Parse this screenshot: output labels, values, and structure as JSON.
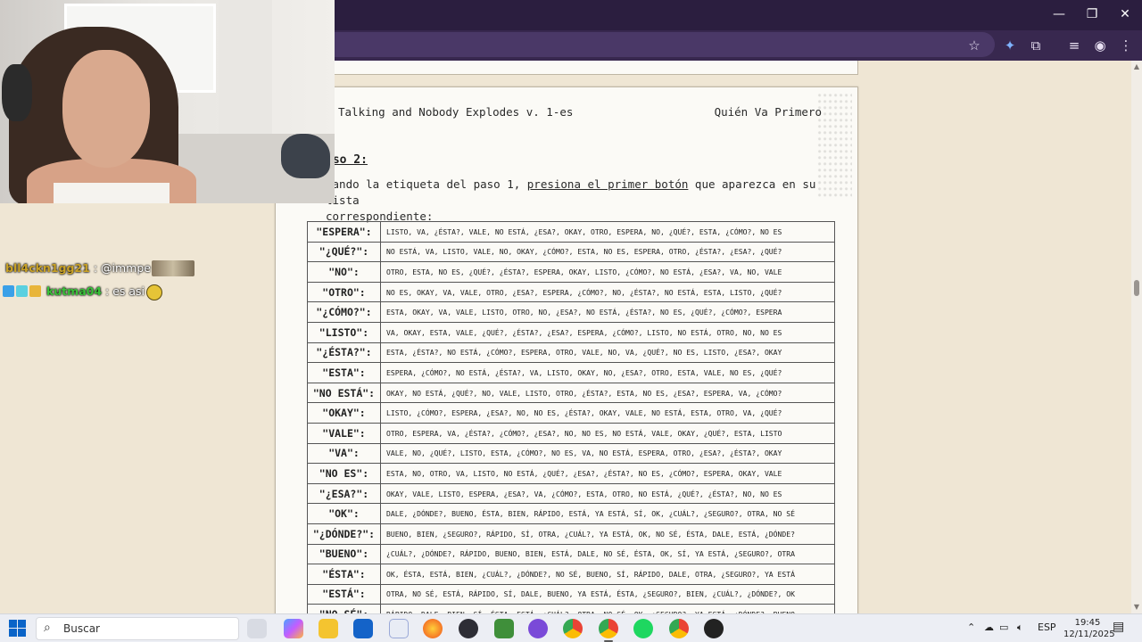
{
  "browser": {
    "window_controls": {
      "minimize": "—",
      "restore": "❐",
      "close": "✕"
    },
    "toolbar_icons": [
      "star-icon",
      "extension-puzzle-icon",
      "media-icon",
      "profile-icon",
      "menu-icon"
    ]
  },
  "document": {
    "header_left": "Talking and Nobody Explodes v. 1-es",
    "header_right": "Quién Va Primero",
    "step_label": "aso 2:",
    "instruction_pre": "sando la etiqueta del paso 1, ",
    "instruction_link": "presiona el primer botón",
    "instruction_post": " que aparezca en su lista",
    "instruction_line2": "correspondiente:",
    "rows": [
      {
        "key": "\"ESPERA\":",
        "list": "LISTO, VA, ¿ÉSTA?, VALE, NO ESTÁ, ¿ESA?, OKAY, OTRO, ESPERA, NO, ¿QUÉ?, ESTA, ¿CÓMO?, NO ES"
      },
      {
        "key": "\"¿QUÉ?\":",
        "list": "NO ESTÁ, VA, LISTO, VALE, NO, OKAY, ¿CÓMO?, ESTA, NO ES, ESPERA, OTRO, ¿ÉSTA?, ¿ESA?, ¿QUÉ?"
      },
      {
        "key": "\"NO\":",
        "list": "OTRO, ESTA, NO ES, ¿QUÉ?, ¿ÉSTA?, ESPERA, OKAY, LISTO, ¿CÓMO?, NO ESTÁ, ¿ESA?, VA, NO, VALE"
      },
      {
        "key": "\"OTRO\":",
        "list": "NO ES, OKAY, VA, VALE, OTRO, ¿ESA?, ESPERA, ¿CÓMO?, NO, ¿ÉSTA?, NO ESTÁ, ESTA, LISTO, ¿QUÉ?"
      },
      {
        "key": "\"¿CÓMO?\":",
        "list": "ESTA, OKAY, VA, VALE, LISTO, OTRO, NO, ¿ESA?, NO ESTÁ, ¿ÉSTA?, NO ES, ¿QUÉ?, ¿CÓMO?, ESPERA"
      },
      {
        "key": "\"LISTO\":",
        "list": "VA, OKAY, ESTA, VALE, ¿QUÉ?, ¿ÉSTA?, ¿ESA?, ESPERA, ¿CÓMO?, LISTO, NO ESTÁ, OTRO, NO, NO ES"
      },
      {
        "key": "\"¿ÉSTA?\":",
        "list": "ESTA, ¿ÉSTA?, NO ESTÁ, ¿CÓMO?, ESPERA, OTRO, VALE, NO, VA, ¿QUÉ?, NO ES, LISTO, ¿ESA?, OKAY"
      },
      {
        "key": "\"ESTA\":",
        "list": "ESPERA, ¿CÓMO?, NO ESTÁ, ¿ÉSTA?, VA, LISTO, OKAY, NO, ¿ESA?, OTRO, ESTA, VALE, NO ES, ¿QUÉ?"
      },
      {
        "key": "\"NO ESTÁ\":",
        "list": "OKAY, NO ESTÁ, ¿QUÉ?, NO, VALE, LISTO, OTRO, ¿ÉSTA?, ESTA, NO ES, ¿ESA?, ESPERA, VA, ¿CÓMO?"
      },
      {
        "key": "\"OKAY\":",
        "list": "LISTO, ¿CÓMO?, ESPERA, ¿ESA?, NO, NO ES, ¿ÉSTA?, OKAY, VALE, NO ESTÁ, ESTA, OTRO, VA, ¿QUÉ?"
      },
      {
        "key": "\"VALE\":",
        "list": "OTRO, ESPERA, VA, ¿ÉSTA?, ¿CÓMO?, ¿ESA?, NO, NO ES, NO ESTÁ, VALE, OKAY, ¿QUÉ?, ESTA, LISTO"
      },
      {
        "key": "\"VA\":",
        "list": "VALE, NO, ¿QUÉ?, LISTO, ESTA, ¿CÓMO?, NO ES, VA, NO ESTÁ, ESPERA, OTRO, ¿ESA?, ¿ÉSTA?, OKAY"
      },
      {
        "key": "\"NO ES\":",
        "list": "ESTA, NO, OTRO, VA, LISTO, NO ESTÁ, ¿QUÉ?, ¿ESA?, ¿ÉSTA?, NO ES, ¿CÓMO?, ESPERA, OKAY, VALE"
      },
      {
        "key": "\"¿ESA?\":",
        "list": "OKAY, VALE, LISTO, ESPERA, ¿ESA?, VA, ¿CÓMO?, ESTA, OTRO, NO ESTÁ, ¿QUÉ?, ¿ÉSTA?, NO, NO ES"
      },
      {
        "key": "\"OK\":",
        "list": "DALE, ¿DÓNDE?, BUENO, ÉSTA, BIEN, RÁPIDO, ESTÁ, YA ESTÁ, SÍ, OK, ¿CUÁL?, ¿SEGURO?, OTRA, NO SÉ"
      },
      {
        "key": "\"¿DÓNDE?\":",
        "list": "BUENO, BIEN, ¿SEGURO?, RÁPIDO, SÍ, OTRA, ¿CUÁL?, YA ESTÁ, OK, NO SÉ, ÉSTA, DALE, ESTÁ, ¿DÓNDE?"
      },
      {
        "key": "\"BUENO\":",
        "list": "¿CUÁL?, ¿DÓNDE?, RÁPIDO, BUENO, BIEN, ESTÁ, DALE, NO SÉ, ÉSTA, OK, SÍ, YA ESTÁ, ¿SEGURO?, OTRA"
      },
      {
        "key": "\"ÉSTA\":",
        "list": "OK, ÉSTA, ESTÁ, BIEN, ¿CUÁL?, ¿DÓNDE?, NO SÉ, BUENO, SÍ, RÁPIDO, DALE, OTRA, ¿SEGURO?, YA ESTÁ"
      },
      {
        "key": "\"ESTÁ\":",
        "list": "OTRA, NO SÉ, ESTÁ, RÁPIDO, SÍ, DALE, BUENO, YA ESTÁ, ÉSTA, ¿SEGURO?, BIEN, ¿CUÁL?, ¿DÓNDE?, OK"
      },
      {
        "key": "\"NO SÉ\":",
        "list": "RÁPIDO, DALE, BIEN, SÍ, ÉSTA, ESTÁ, ¿CUÁL?, OTRA, NO SÉ, OK, ¿SEGURO?, YA ESTÁ, ¿DÓNDE?, BUENO"
      }
    ]
  },
  "chat": [
    {
      "user": "bll4ckn1gg21",
      "message": ": @immpe"
    },
    {
      "user": "kutma04",
      "message": ": es asi"
    }
  ],
  "taskbar": {
    "search_placeholder": "Buscar",
    "language": "ESP",
    "time": "19:45",
    "date": "12/11/2025"
  }
}
